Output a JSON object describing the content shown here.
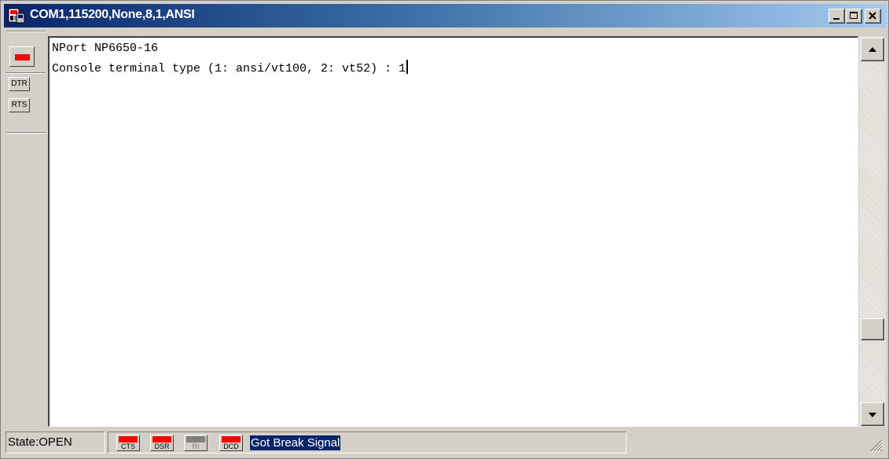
{
  "window": {
    "title": "COM1,115200,None,8,1,ANSI"
  },
  "icons": {
    "app": "terminal-app-icon",
    "minimize": "minimize-icon",
    "maximize": "maximize-icon",
    "close": "close-icon",
    "scroll_up": "arrow-up-icon",
    "scroll_down": "arrow-down-icon",
    "resize_grip": "resize-grip-icon"
  },
  "signals_toolbar": {
    "break_led_color": "#ff0000",
    "dtr_label": "DTR",
    "rts_label": "RTS"
  },
  "terminal": {
    "lines": [
      "NPort NP6650-16",
      "Console terminal type (1: ansi/vt100, 2: vt52) : 1"
    ]
  },
  "statusbar": {
    "state": "State:OPEN",
    "indicators": [
      {
        "label": "CTS",
        "color": "#ff0000"
      },
      {
        "label": "DSR",
        "color": "#ff0000"
      },
      {
        "label": "RI",
        "color": "#808080"
      },
      {
        "label": "DCD",
        "color": "#ff0000"
      }
    ],
    "message": "Got Break Signal"
  },
  "colors": {
    "title_start": "#0a246a",
    "title_end": "#a6caf0",
    "face": "#d4d0c8",
    "highlight": "#0a246a"
  }
}
